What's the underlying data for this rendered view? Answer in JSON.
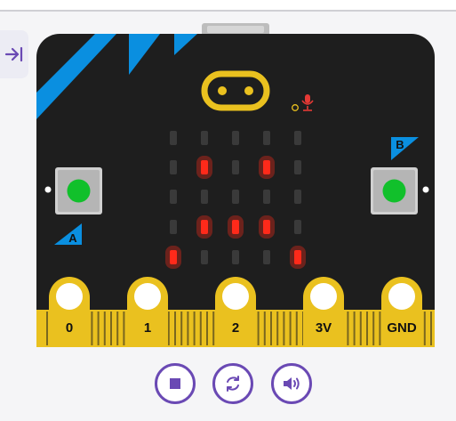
{
  "simulator": {
    "pins": [
      "0",
      "1",
      "2",
      "3V",
      "GND"
    ],
    "button_a_label": "A",
    "button_b_label": "B",
    "led_matrix": [
      [
        0,
        0,
        0,
        0,
        0
      ],
      [
        0,
        1,
        0,
        1,
        0
      ],
      [
        0,
        0,
        0,
        0,
        0
      ],
      [
        0,
        1,
        1,
        1,
        0
      ],
      [
        1,
        0,
        0,
        0,
        1
      ]
    ],
    "colors": {
      "board": "#1e1e1e",
      "accent_blue": "#0a8fe0",
      "gold": "#eac11f",
      "led_on": "#ff2a1a",
      "led_off": "#3a3a3a",
      "button_green": "#11c02b",
      "control_purple": "#6a49b4"
    }
  },
  "controls": [
    {
      "name": "stop-icon"
    },
    {
      "name": "restart-icon"
    },
    {
      "name": "speaker-icon"
    }
  ]
}
